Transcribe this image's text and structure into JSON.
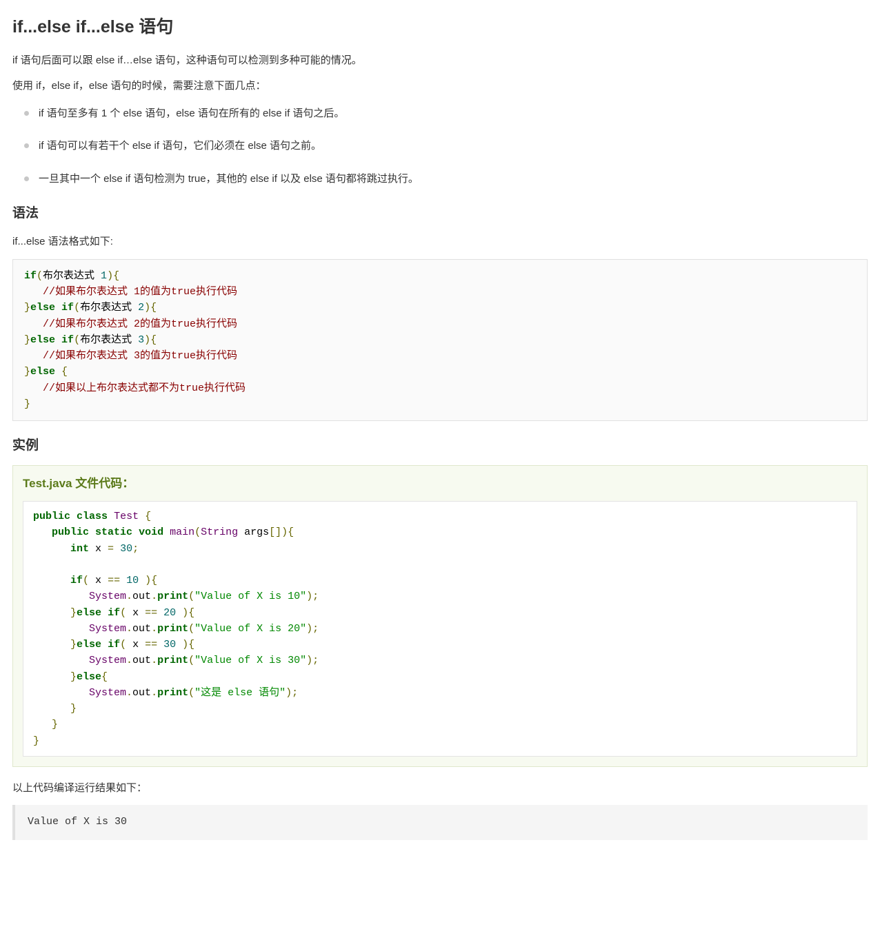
{
  "heading_main": "if...else if...else 语句",
  "intro_p1": "if 语句后面可以跟 else if…else 语句，这种语句可以检测到多种可能的情况。",
  "intro_p2": "使用 if，else if，else 语句的时候，需要注意下面几点：",
  "rules": [
    "if 语句至多有 1 个 else 语句，else 语句在所有的 else if 语句之后。",
    "if 语句可以有若干个 else if 语句，它们必须在 else 语句之前。",
    "一旦其中一个 else if 语句检测为 true，其他的 else if 以及 else 语句都将跳过执行。"
  ],
  "heading_syntax": "语法",
  "syntax_intro": "if...else 语法格式如下:",
  "syntax_tokens": [
    [
      "kw",
      "if"
    ],
    [
      "pun",
      "("
    ],
    [
      "pln",
      "布尔表达式 "
    ],
    [
      "lit",
      "1"
    ],
    [
      "pun",
      "){"
    ],
    [
      "nl",
      ""
    ],
    [
      "pln",
      "   "
    ],
    [
      "com",
      "//如果布尔表达式 1的值为true执行代码"
    ],
    [
      "nl",
      ""
    ],
    [
      "pun",
      "}"
    ],
    [
      "kw",
      "else"
    ],
    [
      "pln",
      " "
    ],
    [
      "kw",
      "if"
    ],
    [
      "pun",
      "("
    ],
    [
      "pln",
      "布尔表达式 "
    ],
    [
      "lit",
      "2"
    ],
    [
      "pun",
      "){"
    ],
    [
      "nl",
      ""
    ],
    [
      "pln",
      "   "
    ],
    [
      "com",
      "//如果布尔表达式 2的值为true执行代码"
    ],
    [
      "nl",
      ""
    ],
    [
      "pun",
      "}"
    ],
    [
      "kw",
      "else"
    ],
    [
      "pln",
      " "
    ],
    [
      "kw",
      "if"
    ],
    [
      "pun",
      "("
    ],
    [
      "pln",
      "布尔表达式 "
    ],
    [
      "lit",
      "3"
    ],
    [
      "pun",
      "){"
    ],
    [
      "nl",
      ""
    ],
    [
      "pln",
      "   "
    ],
    [
      "com",
      "//如果布尔表达式 3的值为true执行代码"
    ],
    [
      "nl",
      ""
    ],
    [
      "pun",
      "}"
    ],
    [
      "kw",
      "else"
    ],
    [
      "pln",
      " "
    ],
    [
      "pun",
      "{"
    ],
    [
      "nl",
      ""
    ],
    [
      "pln",
      "   "
    ],
    [
      "com",
      "//如果以上布尔表达式都不为true执行代码"
    ],
    [
      "nl",
      ""
    ],
    [
      "pun",
      "}"
    ]
  ],
  "heading_example": "实例",
  "example_title": "Test.java 文件代码：",
  "example_tokens": [
    [
      "kw",
      "public"
    ],
    [
      "pln",
      " "
    ],
    [
      "kw",
      "class"
    ],
    [
      "pln",
      " "
    ],
    [
      "typ",
      "Test"
    ],
    [
      "pln",
      " "
    ],
    [
      "pun",
      "{"
    ],
    [
      "nl",
      ""
    ],
    [
      "pln",
      "   "
    ],
    [
      "kw",
      "public"
    ],
    [
      "pln",
      " "
    ],
    [
      "kw",
      "static"
    ],
    [
      "pln",
      " "
    ],
    [
      "kw",
      "void"
    ],
    [
      "pln",
      " "
    ],
    [
      "typ",
      "main"
    ],
    [
      "pun",
      "("
    ],
    [
      "typ",
      "String"
    ],
    [
      "pln",
      " args"
    ],
    [
      "pun",
      "[]){"
    ],
    [
      "nl",
      ""
    ],
    [
      "pln",
      "      "
    ],
    [
      "kw",
      "int"
    ],
    [
      "pln",
      " x "
    ],
    [
      "pun",
      "="
    ],
    [
      "pln",
      " "
    ],
    [
      "lit",
      "30"
    ],
    [
      "pun",
      ";"
    ],
    [
      "nl",
      ""
    ],
    [
      "nl",
      ""
    ],
    [
      "pln",
      "      "
    ],
    [
      "kw",
      "if"
    ],
    [
      "pun",
      "("
    ],
    [
      "pln",
      " x "
    ],
    [
      "pun",
      "=="
    ],
    [
      "pln",
      " "
    ],
    [
      "lit",
      "10"
    ],
    [
      "pln",
      " "
    ],
    [
      "pun",
      "){"
    ],
    [
      "nl",
      ""
    ],
    [
      "pln",
      "         "
    ],
    [
      "typ",
      "System"
    ],
    [
      "pun",
      "."
    ],
    [
      "pln",
      "out"
    ],
    [
      "pun",
      "."
    ],
    [
      "kw",
      "print"
    ],
    [
      "pun",
      "("
    ],
    [
      "str",
      "\"Value of X is 10\""
    ],
    [
      "pun",
      ");"
    ],
    [
      "nl",
      ""
    ],
    [
      "pln",
      "      "
    ],
    [
      "pun",
      "}"
    ],
    [
      "kw",
      "else"
    ],
    [
      "pln",
      " "
    ],
    [
      "kw",
      "if"
    ],
    [
      "pun",
      "("
    ],
    [
      "pln",
      " x "
    ],
    [
      "pun",
      "=="
    ],
    [
      "pln",
      " "
    ],
    [
      "lit",
      "20"
    ],
    [
      "pln",
      " "
    ],
    [
      "pun",
      "){"
    ],
    [
      "nl",
      ""
    ],
    [
      "pln",
      "         "
    ],
    [
      "typ",
      "System"
    ],
    [
      "pun",
      "."
    ],
    [
      "pln",
      "out"
    ],
    [
      "pun",
      "."
    ],
    [
      "kw",
      "print"
    ],
    [
      "pun",
      "("
    ],
    [
      "str",
      "\"Value of X is 20\""
    ],
    [
      "pun",
      ");"
    ],
    [
      "nl",
      ""
    ],
    [
      "pln",
      "      "
    ],
    [
      "pun",
      "}"
    ],
    [
      "kw",
      "else"
    ],
    [
      "pln",
      " "
    ],
    [
      "kw",
      "if"
    ],
    [
      "pun",
      "("
    ],
    [
      "pln",
      " x "
    ],
    [
      "pun",
      "=="
    ],
    [
      "pln",
      " "
    ],
    [
      "lit",
      "30"
    ],
    [
      "pln",
      " "
    ],
    [
      "pun",
      "){"
    ],
    [
      "nl",
      ""
    ],
    [
      "pln",
      "         "
    ],
    [
      "typ",
      "System"
    ],
    [
      "pun",
      "."
    ],
    [
      "pln",
      "out"
    ],
    [
      "pun",
      "."
    ],
    [
      "kw",
      "print"
    ],
    [
      "pun",
      "("
    ],
    [
      "str",
      "\"Value of X is 30\""
    ],
    [
      "pun",
      ");"
    ],
    [
      "nl",
      ""
    ],
    [
      "pln",
      "      "
    ],
    [
      "pun",
      "}"
    ],
    [
      "kw",
      "else"
    ],
    [
      "pun",
      "{"
    ],
    [
      "nl",
      ""
    ],
    [
      "pln",
      "         "
    ],
    [
      "typ",
      "System"
    ],
    [
      "pun",
      "."
    ],
    [
      "pln",
      "out"
    ],
    [
      "pun",
      "."
    ],
    [
      "kw",
      "print"
    ],
    [
      "pun",
      "("
    ],
    [
      "str",
      "\"这是 else 语句\""
    ],
    [
      "pun",
      ");"
    ],
    [
      "nl",
      ""
    ],
    [
      "pln",
      "      "
    ],
    [
      "pun",
      "}"
    ],
    [
      "nl",
      ""
    ],
    [
      "pln",
      "   "
    ],
    [
      "pun",
      "}"
    ],
    [
      "nl",
      ""
    ],
    [
      "pun",
      "}"
    ]
  ],
  "output_intro": "以上代码编译运行结果如下：",
  "output_text": "Value of X is 30"
}
